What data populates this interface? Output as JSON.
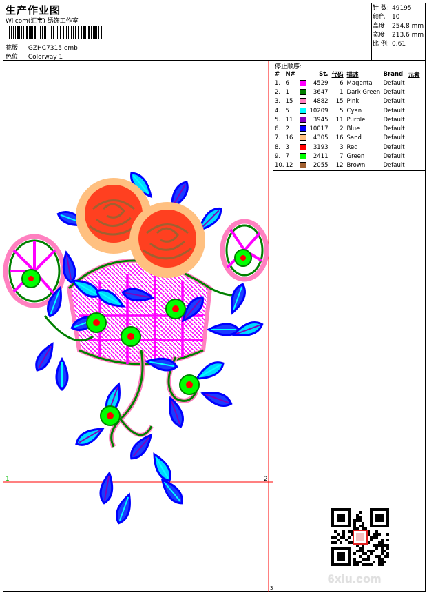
{
  "header": {
    "title": "生产作业图",
    "subtitle": "Wilcom(汇宝) 绣饰工作室",
    "design_label": "花版:",
    "design_value": "GZHC7315.emb",
    "colorway_label": "色位:",
    "colorway_value": "Colorway 1"
  },
  "stats": [
    {
      "label": "针 数:",
      "value": "49195"
    },
    {
      "label": "颜色:",
      "value": "10"
    },
    {
      "label": "高度:",
      "value": "254.8 mm"
    },
    {
      "label": "宽度:",
      "value": "213.6 mm"
    },
    {
      "label": "比 例:",
      "value": "0.61"
    }
  ],
  "stop_sequence": {
    "title": "停止顺序:",
    "headers": [
      "#",
      "N#",
      "St.",
      "代码",
      "描述",
      "Brand",
      "元素"
    ],
    "rows": [
      {
        "num": "1.",
        "n": "6",
        "color": "#ff00ff",
        "st": "4529",
        "code": "6",
        "desc": "Magenta",
        "brand": "Default"
      },
      {
        "num": "2.",
        "n": "1",
        "color": "#008000",
        "st": "3647",
        "code": "1",
        "desc": "Dark Green",
        "brand": "Default"
      },
      {
        "num": "3.",
        "n": "15",
        "color": "#ff80c0",
        "st": "4882",
        "code": "15",
        "desc": "Pink",
        "brand": "Default"
      },
      {
        "num": "4.",
        "n": "5",
        "color": "#00ffff",
        "st": "10209",
        "code": "5",
        "desc": "Cyan",
        "brand": "Default"
      },
      {
        "num": "5.",
        "n": "11",
        "color": "#8000c0",
        "st": "3945",
        "code": "11",
        "desc": "Purple",
        "brand": "Default"
      },
      {
        "num": "6.",
        "n": "2",
        "color": "#0000ff",
        "st": "10017",
        "code": "2",
        "desc": "Blue",
        "brand": "Default"
      },
      {
        "num": "7.",
        "n": "16",
        "color": "#ffc080",
        "st": "4305",
        "code": "16",
        "desc": "Sand",
        "brand": "Default"
      },
      {
        "num": "8.",
        "n": "3",
        "color": "#ff0000",
        "st": "3193",
        "code": "3",
        "desc": "Red",
        "brand": "Default"
      },
      {
        "num": "9.",
        "n": "7",
        "color": "#00ff00",
        "st": "2411",
        "code": "7",
        "desc": "Green",
        "brand": "Default"
      },
      {
        "num": "10.",
        "n": "12",
        "color": "#a06030",
        "st": "2055",
        "code": "12",
        "desc": "Brown",
        "brand": "Default"
      }
    ]
  },
  "canvas": {
    "marker_1": "1",
    "marker_2": "2",
    "marker_3": "3"
  },
  "watermark": "6xiu.com"
}
